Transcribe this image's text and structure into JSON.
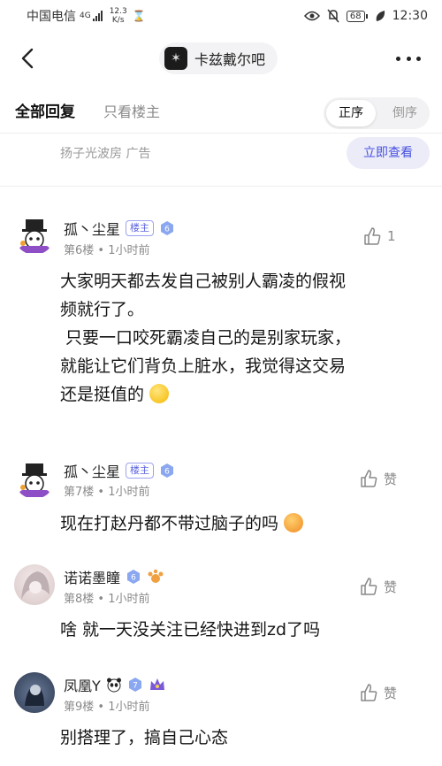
{
  "status_bar": {
    "carrier": "中国电信",
    "network_type": "4G",
    "speed_value": "12.3",
    "speed_unit": "K/s",
    "battery": "68",
    "time": "12:30"
  },
  "header": {
    "forum_name": "卡兹戴尔吧"
  },
  "tabs": {
    "all_replies": "全部回复",
    "owner_only": "只看楼主",
    "sort_asc": "正序",
    "sort_desc": "倒序"
  },
  "ad": {
    "label": "扬子光波房 广告",
    "button": "立即查看"
  },
  "posts": [
    {
      "username": "孤丶尘星",
      "owner_badge": "楼主",
      "level": "6",
      "meta": "第6楼 • 1小时前",
      "like_count": "1",
      "content_lines": [
        "大家明天都去发自己被别人霸凌的假视",
        "频就行了。",
        " 只要一口咬死霸凌自己的是别家玩家，",
        "就能让它们背负上脏水，我觉得这交易",
        "还是挺值的"
      ]
    },
    {
      "username": "孤丶尘星",
      "owner_badge": "楼主",
      "level": "6",
      "meta": "第7楼 • 1小时前",
      "like_label": "赞",
      "content": "现在打赵丹都不带过脑子的吗"
    },
    {
      "username": "诺诺墨瞳",
      "level": "6",
      "meta": "第8楼 • 1小时前",
      "like_label": "赞",
      "content": "啥 就一天没关注已经快进到zd了吗"
    },
    {
      "username": "凤凰Y",
      "level": "7",
      "meta": "第9楼 • 1小时前",
      "like_label": "赞",
      "content": "别搭理了，搞自己心态"
    }
  ],
  "colors": {
    "accent": "#4650e0",
    "accent_bg": "#ececf8",
    "muted": "#8a8a8a"
  }
}
